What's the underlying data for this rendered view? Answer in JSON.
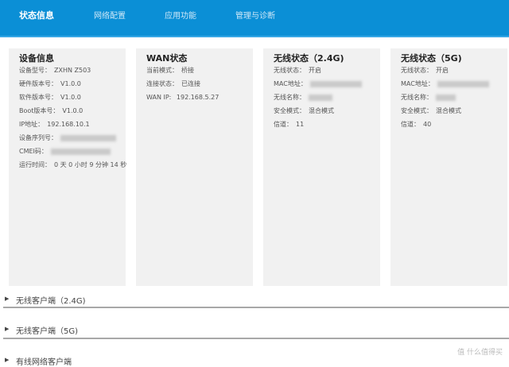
{
  "nav": [
    "状态信息",
    "网络配置",
    "应用功能",
    "管理与诊断"
  ],
  "device": {
    "title": "设备信息",
    "rows": [
      {
        "label": "设备型号：",
        "value": "ZXHN Z503"
      },
      {
        "label": "硬件版本号：",
        "value": "V1.0.0"
      },
      {
        "label": "软件版本号：",
        "value": "V1.0.0"
      },
      {
        "label": "Boot版本号：",
        "value": "V1.0.0"
      },
      {
        "label": "IP地址：",
        "value": "192.168.10.1"
      },
      {
        "label": "设备序列号：",
        "value": null
      },
      {
        "label": "CMEI码：",
        "value": null
      },
      {
        "label": "运行时间：",
        "value": "0 天 0 小时 9 分钟 14 秒"
      }
    ]
  },
  "wan": {
    "title": "WAN状态",
    "rows": [
      {
        "label": "当前模式：",
        "value": "桥接"
      },
      {
        "label": "连接状态：",
        "value": "已连接"
      },
      {
        "label": "WAN IP: ",
        "value": "192.168.5.27"
      }
    ]
  },
  "wifi24": {
    "title": "无线状态（2.4G)",
    "rows": [
      {
        "label": "无线状态：",
        "value": "开启"
      },
      {
        "label": "MAC地址：",
        "value": null
      },
      {
        "label": "无线名称：",
        "value": null
      },
      {
        "label": "安全模式：",
        "value": "混合模式"
      },
      {
        "label": "信道：",
        "value": "11"
      }
    ]
  },
  "wifi5": {
    "title": "无线状态（5G)",
    "rows": [
      {
        "label": "无线状态：",
        "value": "开启"
      },
      {
        "label": "MAC地址：",
        "value": null
      },
      {
        "label": "无线名称：",
        "value": null
      },
      {
        "label": "安全模式：",
        "value": "混合模式"
      },
      {
        "label": "信道：",
        "value": "40"
      }
    ]
  },
  "sections": [
    "无线客户端（2.4G)",
    "无线客户端（5G)",
    "有线网络客户端"
  ],
  "watermark": "值 什么值得买"
}
